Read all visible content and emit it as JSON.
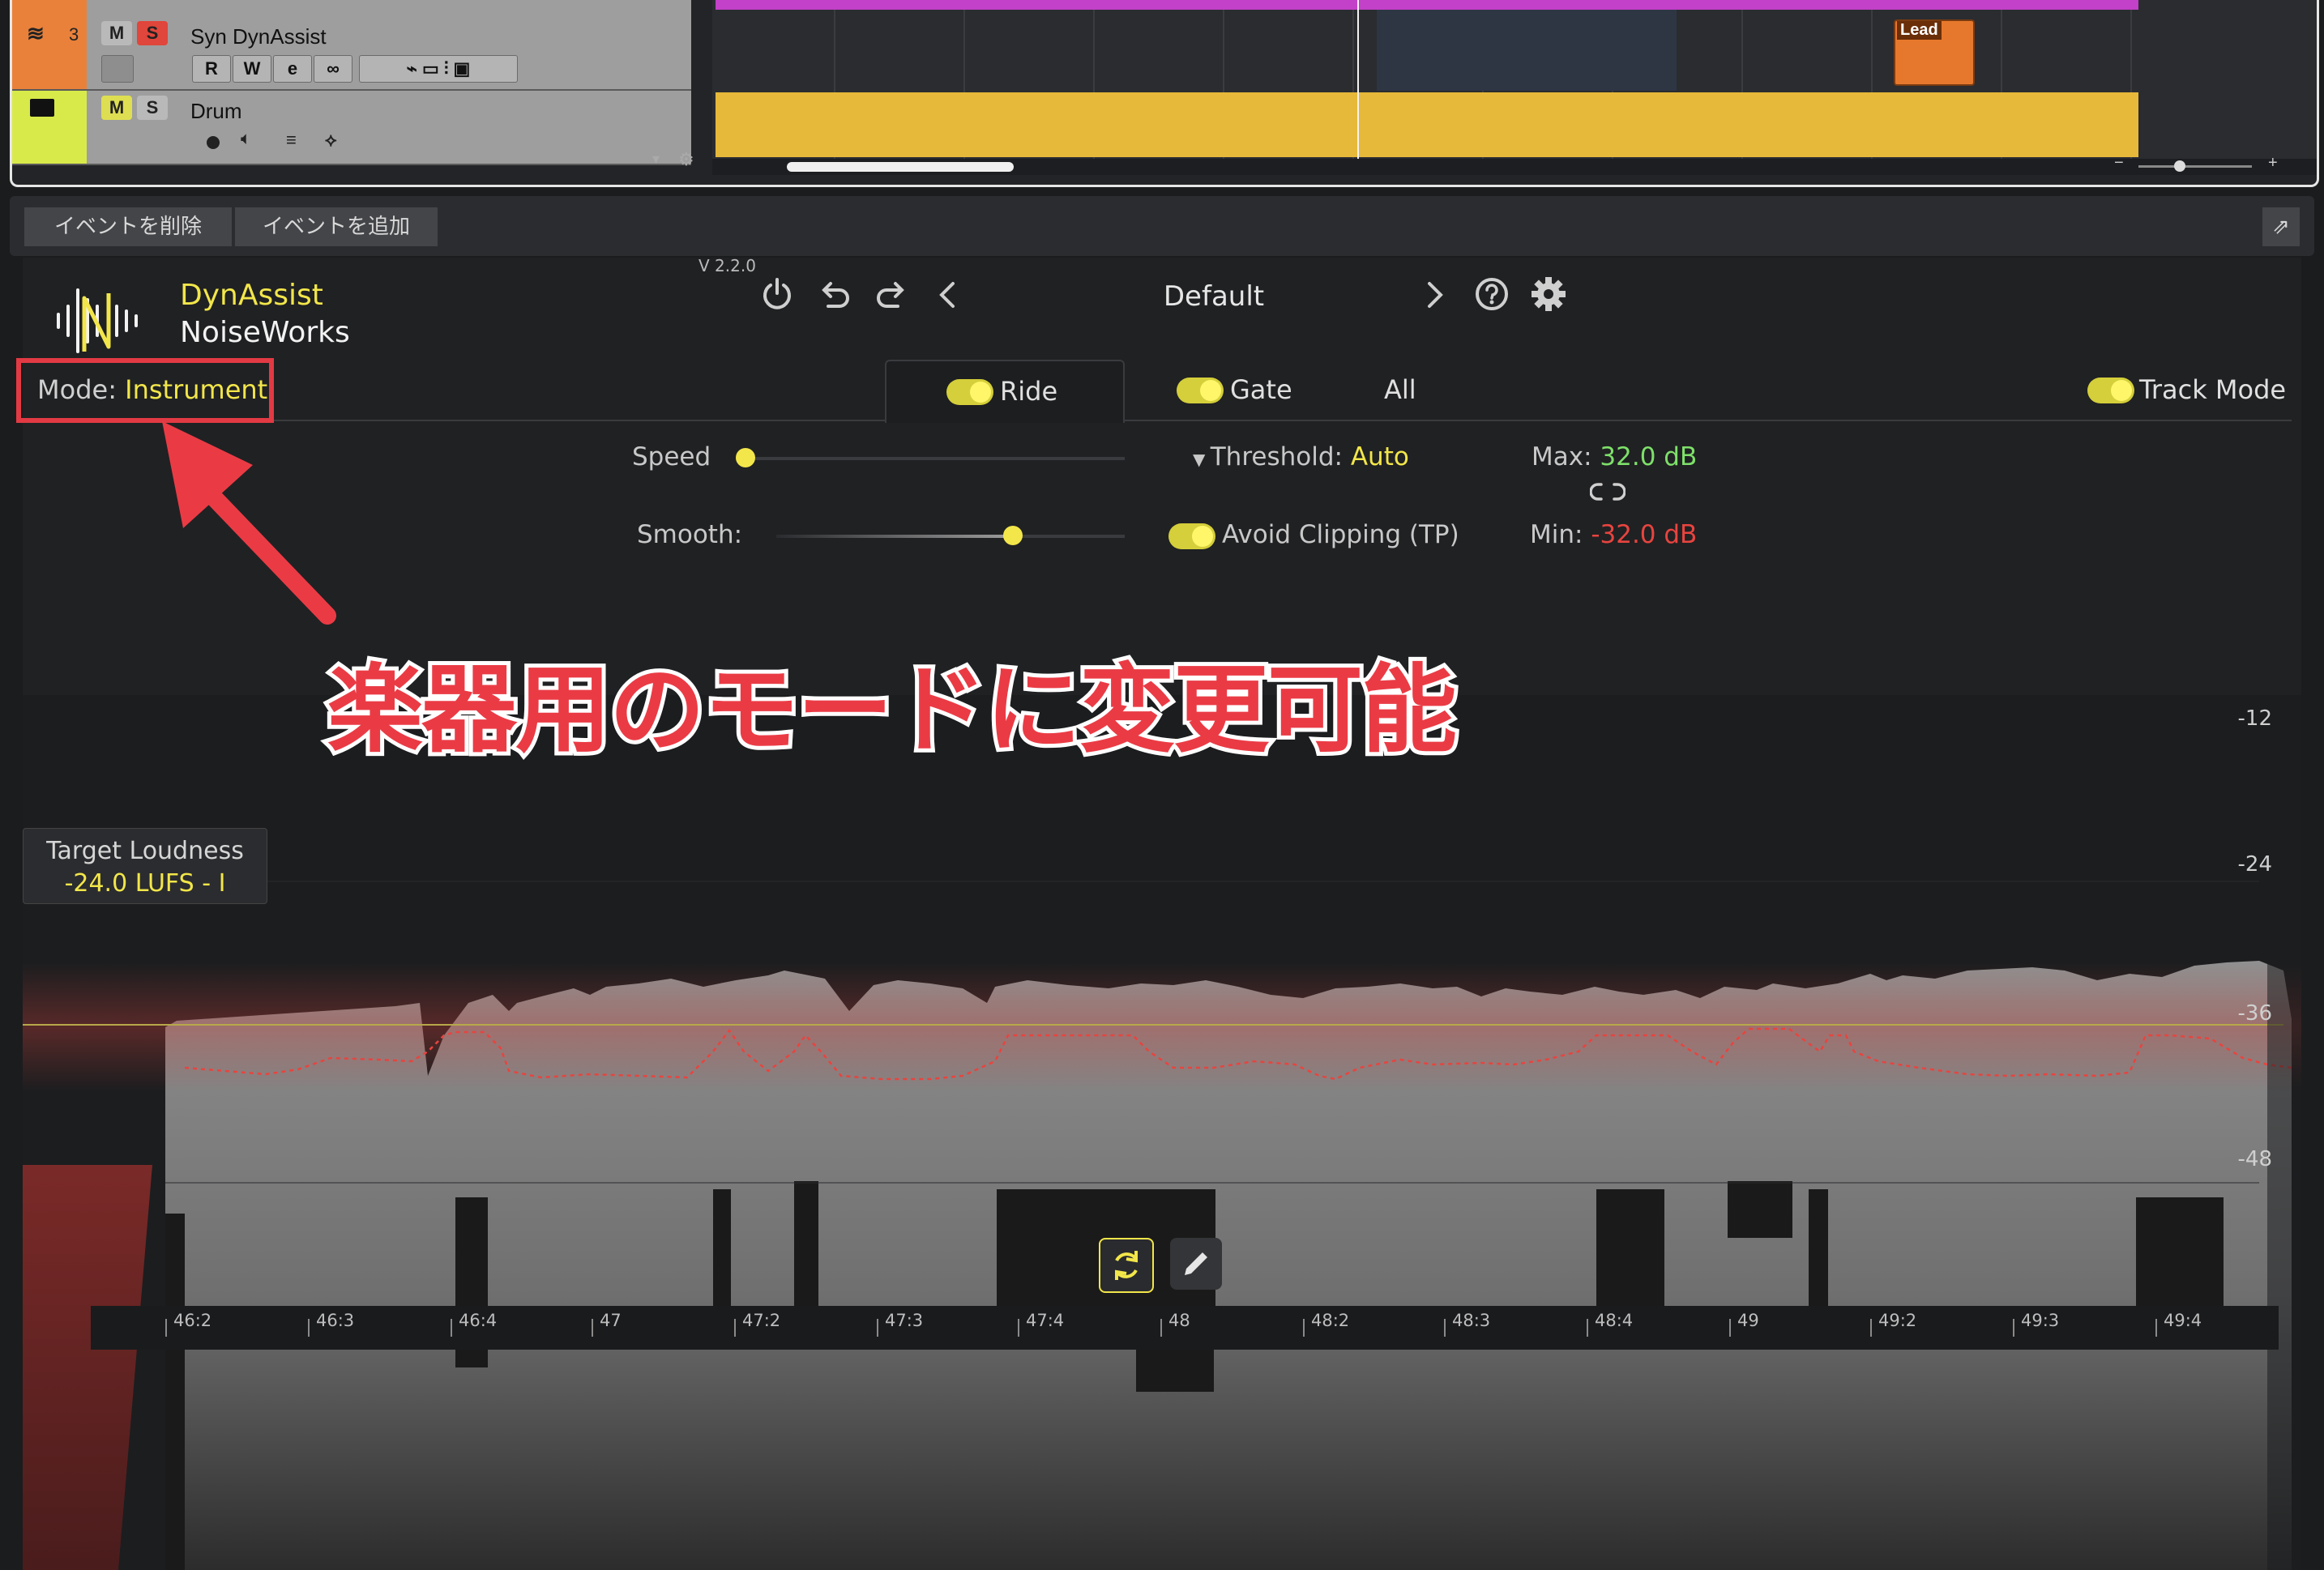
{
  "tracks": [
    {
      "number": "3",
      "name": "Syn DynAssist",
      "mute": "M",
      "solo": "S",
      "read": "R",
      "write": "W",
      "color": "#e9813b"
    },
    {
      "name": "Drum",
      "mute": "M",
      "solo": "S",
      "color": "#d8ea4a"
    }
  ],
  "arrange": {
    "clip_label": "Lead",
    "drum_color": "#e7b93a",
    "clip_color": "#e6782d",
    "top_clip_color": "#c340c8"
  },
  "toolbar": {
    "delete_events": "イベントを削除",
    "add_events": "イベントを追加"
  },
  "plugin": {
    "version": "V 2.2.0",
    "brand_line1": "DynAssist",
    "brand_line2": "NoiseWorks",
    "preset": "Default",
    "mode_label": "Mode:",
    "mode_value": "Instrument",
    "tabs": {
      "ride": "Ride",
      "gate": "Gate",
      "all": "All",
      "track_mode": "Track Mode"
    },
    "speed_label": "Speed",
    "smooth_label": "Smooth:",
    "speed_level": 0.0,
    "smooth_level": 0.66,
    "threshold_label": "Threshold:",
    "threshold_value": "Auto",
    "avoid_clipping": "Avoid Clipping (TP)",
    "max_label": "Max:",
    "max_value": "32.0 dB",
    "min_label": "Min:",
    "min_value": "-32.0 dB",
    "target_label": "Target Loudness",
    "target_value": "-24.0 LUFS - I",
    "db_scale": [
      "-12",
      "-24",
      "-36",
      "-48"
    ],
    "timeline": [
      "46:2",
      "46:3",
      "46:4",
      "47",
      "47:2",
      "47:3",
      "47:4",
      "48",
      "48:2",
      "48:3",
      "48:4",
      "49",
      "49:2",
      "49:3",
      "49:4"
    ],
    "accent_yellow": "#f2e64a",
    "accent_green": "#7ee06a",
    "accent_red": "#e8443f"
  },
  "annotation": {
    "text": "楽器用のモードに変更可能",
    "color": "#ea3b45"
  }
}
